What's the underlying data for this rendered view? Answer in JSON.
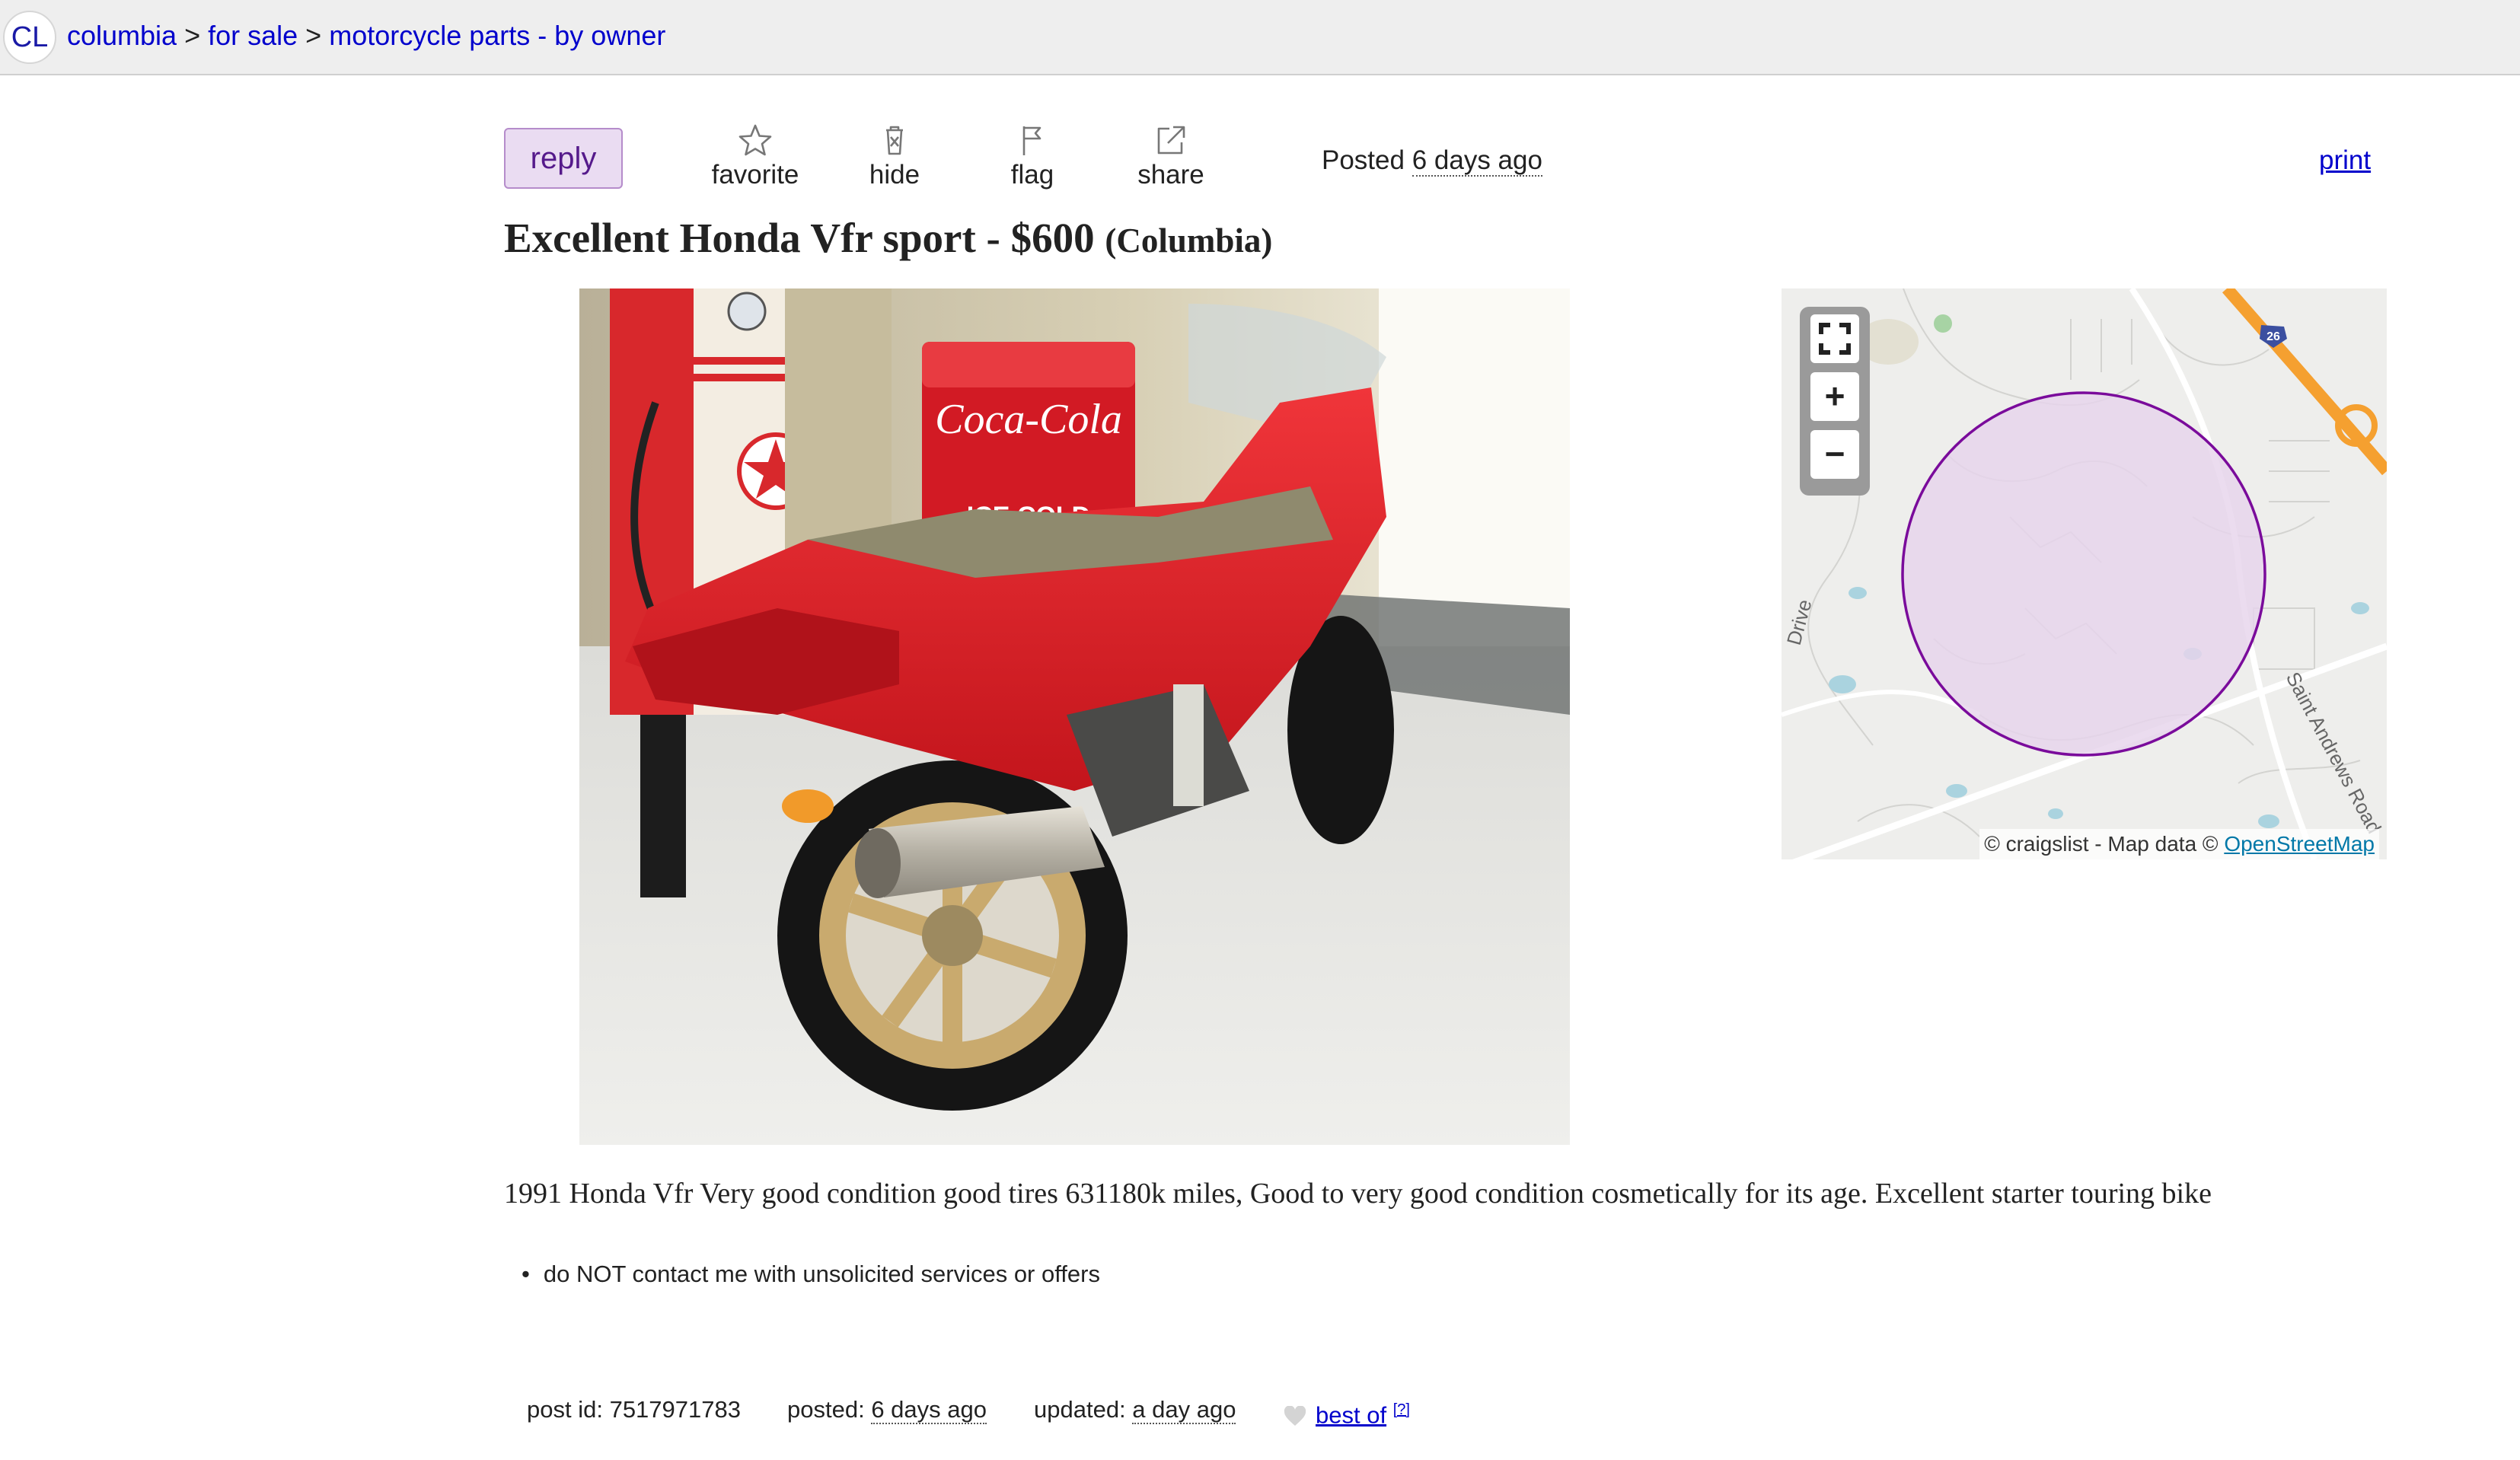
{
  "breadcrumb": {
    "logo": "CL",
    "items": [
      "columbia",
      "for sale",
      "motorcycle parts - by owner"
    ],
    "separator": ">"
  },
  "actions": {
    "reply": "reply",
    "favorite": "favorite",
    "hide": "hide",
    "flag": "flag",
    "share": "share",
    "posted_prefix": "Posted",
    "posted_when": "6 days ago",
    "print": "print"
  },
  "posting": {
    "title": "Excellent Honda Vfr sport - $600",
    "location": "(Columbia)",
    "body": "1991 Honda Vfr Very good condition good tires 631180k miles, Good to very good condition cosmetically for its age. Excellent starter touring bike",
    "notices": [
      "do NOT contact me with unsolicited services or offers"
    ]
  },
  "map": {
    "attribution_prefix": "© craigslist - Map data ©",
    "attribution_link": "OpenStreetMap",
    "zoom_in": "+",
    "zoom_out": "−",
    "fullscreen_icon": "fullscreen-icon",
    "labels": [
      "Saint Andrews Road",
      "Drive",
      "26"
    ],
    "area_color": "#e6d4ec",
    "area_border_color": "#7a0b9b",
    "interstate_color": "#f5a030"
  },
  "photo": {
    "icons": [
      "motorcycle",
      "coca-cola-cooler",
      "texaco-gas-pump"
    ],
    "cooler_brand": "Coca-Cola",
    "cooler_caption": "ICE COLD"
  },
  "postinfo": {
    "post_id_label": "post id:",
    "post_id": "7517971783",
    "posted_label": "posted:",
    "posted_value": "6 days ago",
    "updated_label": "updated:",
    "updated_value": "a day ago",
    "best_of": "best of",
    "best_of_help": "[?]"
  },
  "colors": {
    "link": "#0000cc",
    "reply_bg": "#eadcf2",
    "reply_text": "#551a8b",
    "header_bg": "#eeeeee"
  }
}
